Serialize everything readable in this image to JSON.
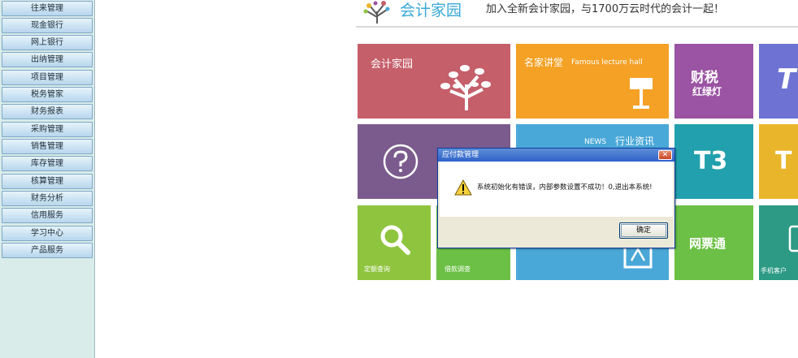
{
  "sidebar": {
    "items": [
      "往来管理",
      "现金银行",
      "网上银行",
      "出纳管理",
      "项目管理",
      "税务管家",
      "财务报表",
      "采购管理",
      "销售管理",
      "库存管理",
      "核算管理",
      "财务分析",
      "信用服务",
      "学习中心",
      "产品服务"
    ]
  },
  "header": {
    "logo_text": "会计家园",
    "tagline": "加入全新会计家园，与1700万云时代的会计一起！"
  },
  "tiles": {
    "kuaiji_jiayuan": "会计家园",
    "mingjia_jiangtang": "名家讲堂",
    "mingjia_en": "Famous lecture hall",
    "caishui_1": "财税",
    "caishui_2": "红绿灯",
    "t_partial": "T",
    "news": "NEWS",
    "hangye_zixun": "行业资讯",
    "t3": "T3",
    "t_partial_2": "T",
    "wangpiaotong": "网票通",
    "dingdan_chaxun": "定额查询",
    "tile_small_2": "借款调查",
    "shouji_kehu": "手机客户"
  },
  "dialog": {
    "title": "应付款管理",
    "message": "系统初始化有错误，内部参数设置不成功！0,退出本系统!",
    "ok_label": "确定",
    "close_glyph": "✕"
  },
  "colors": {
    "tile_red": "#c55f6a",
    "tile_orange": "#f4a125",
    "tile_purple": "#9b53a3",
    "tile_blue_violet": "#6e72d2",
    "tile_dark_purple": "#7b5b8e",
    "tile_sky": "#4aa8d8",
    "tile_teal": "#23a0ad",
    "tile_yellow": "#e9b52a",
    "tile_green": "#8fc43f",
    "tile_green2": "#6bc045",
    "tile_teal_green": "#2c9a84"
  }
}
